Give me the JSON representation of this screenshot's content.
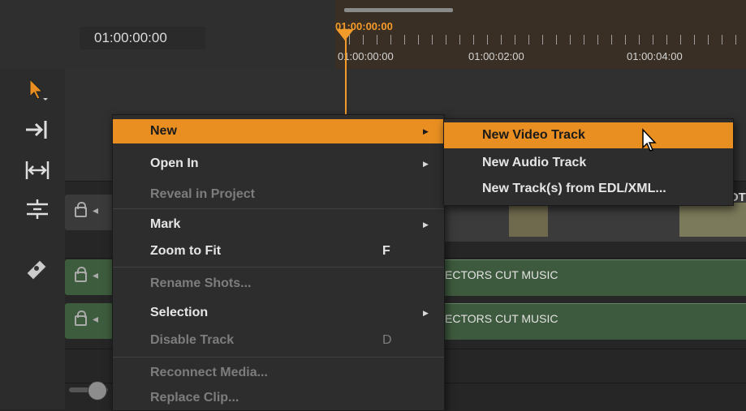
{
  "timeline": {
    "current_timecode": "01:00:00:00",
    "playhead_time": "01:00:00:00",
    "ruler_labels": [
      "01:00:00:00",
      "01:00:02:00",
      "01:00:04:00"
    ]
  },
  "tracks": {
    "clip_label": "OT",
    "audio_clips": [
      "ECTORS CUT MUSIC",
      "ECTORS CUT MUSIC"
    ]
  },
  "toolbar": {
    "tools": [
      "selection-tool",
      "track-forward-tool",
      "ripple-tool",
      "slip-tool",
      "razor-tool"
    ]
  },
  "context_menu": {
    "items": [
      {
        "label": "New",
        "shortcut": "",
        "submenu": true,
        "enabled": true,
        "highlighted": true
      },
      {
        "label": "Open In",
        "shortcut": "",
        "submenu": true,
        "enabled": true
      },
      {
        "label": "Reveal in Project",
        "shortcut": "",
        "submenu": false,
        "enabled": false
      },
      {
        "label": "Mark",
        "shortcut": "",
        "submenu": true,
        "enabled": true
      },
      {
        "label": "Zoom to Fit",
        "shortcut": "F",
        "submenu": false,
        "enabled": true
      },
      {
        "label": "Rename Shots...",
        "shortcut": "",
        "submenu": false,
        "enabled": false
      },
      {
        "label": "Selection",
        "shortcut": "",
        "submenu": true,
        "enabled": true
      },
      {
        "label": "Disable Track",
        "shortcut": "D",
        "submenu": false,
        "enabled": false
      },
      {
        "label": "Reconnect Media...",
        "shortcut": "",
        "submenu": false,
        "enabled": false
      },
      {
        "label": "Replace Clip...",
        "shortcut": "",
        "submenu": false,
        "enabled": false
      }
    ]
  },
  "submenu": {
    "items": [
      {
        "label": "New Video Track",
        "highlighted": true
      },
      {
        "label": "New Audio Track"
      },
      {
        "label": "New Track(s) from EDL/XML..."
      }
    ]
  },
  "colors": {
    "accent": "#e98f21",
    "background": "#262626",
    "menu": "#2d2d2d",
    "audio_track": "#3e5a3e"
  }
}
